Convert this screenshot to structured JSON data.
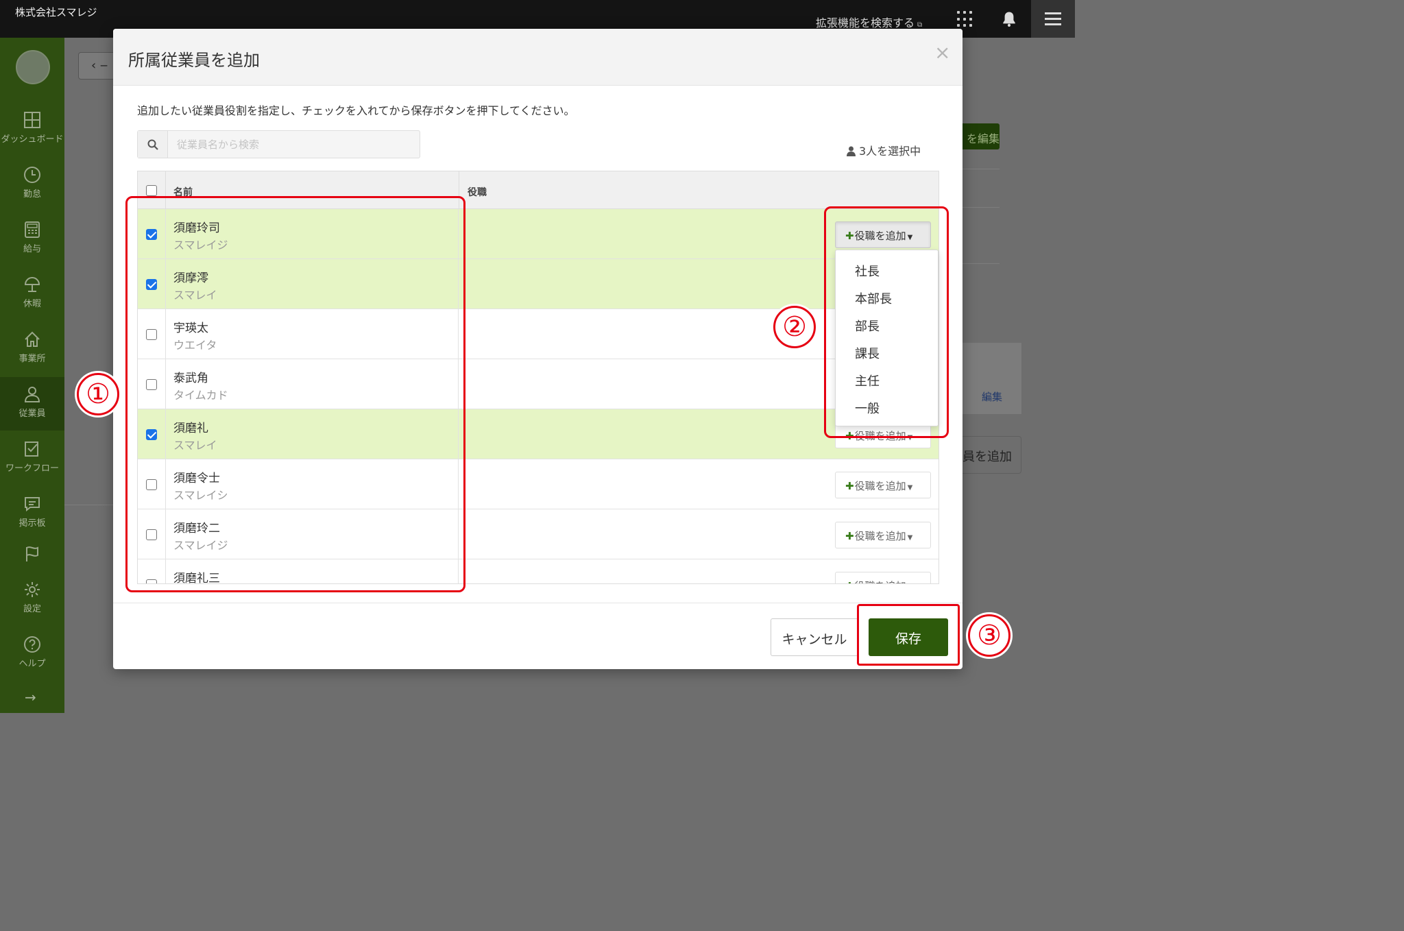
{
  "topbar": {
    "company": "株式会社スマレジ",
    "ext_search": "拡張機能を検索する",
    "ext_icon": "external-link-icon"
  },
  "sidebar": {
    "items": [
      {
        "label": "ダッシュボード",
        "icon": "dashboard-icon"
      },
      {
        "label": "勤怠",
        "icon": "clock-icon"
      },
      {
        "label": "給与",
        "icon": "calculator-icon"
      },
      {
        "label": "休暇",
        "icon": "umbrella-icon"
      },
      {
        "label": "事業所",
        "icon": "home-icon"
      },
      {
        "label": "従業員",
        "icon": "person-icon"
      },
      {
        "label": "ワークフロー",
        "icon": "checklist-icon"
      },
      {
        "label": "掲示板",
        "icon": "chat-icon"
      },
      {
        "label": "",
        "icon": "flag-icon"
      },
      {
        "label": "設定",
        "icon": "gear-icon"
      },
      {
        "label": "ヘルプ",
        "icon": "help-icon"
      }
    ],
    "expand_arrow": "→"
  },
  "background": {
    "back_label": "‹ ‒",
    "edit_label": "を編集",
    "card_link": "編集",
    "add_label": "員を追加"
  },
  "modal": {
    "title": "所属従業員を追加",
    "close": "×",
    "instruction": "追加したい従業員役割を指定し、チェックを入れてから保存ボタンを押下してください。",
    "search_placeholder": "従業員名から検索",
    "selected_count": "3人を選択中",
    "columns": {
      "name": "名前",
      "role": "役職"
    },
    "rows": [
      {
        "name": "須磨玲司",
        "kana": "スマレイジ",
        "checked": true
      },
      {
        "name": "須摩澪",
        "kana": "スマレイ",
        "checked": true
      },
      {
        "name": "宇瑛太",
        "kana": "ウエイタ",
        "checked": false
      },
      {
        "name": "泰武角",
        "kana": "タイムカド",
        "checked": false
      },
      {
        "name": "須磨礼",
        "kana": "スマレイ",
        "checked": true
      },
      {
        "name": "須磨令士",
        "kana": "スマレイシ",
        "checked": false
      },
      {
        "name": "須磨玲二",
        "kana": "スマレイジ",
        "checked": false
      },
      {
        "name": "須磨礼三",
        "kana": "",
        "checked": false
      }
    ],
    "add_role_label": "役職を追加",
    "dropdown_options": [
      "社長",
      "本部長",
      "部長",
      "課長",
      "主任",
      "一般"
    ],
    "cancel_label": "キャンセル",
    "save_label": "保存"
  },
  "annotations": {
    "step1": "①",
    "step2": "②",
    "step3": "③",
    "color": "#e60012"
  },
  "colors": {
    "sidebar": "#2f4f11",
    "selected_row": "#e6f5c5",
    "save_button": "#2d5a0b",
    "checkbox_checked": "#1a73e8"
  }
}
